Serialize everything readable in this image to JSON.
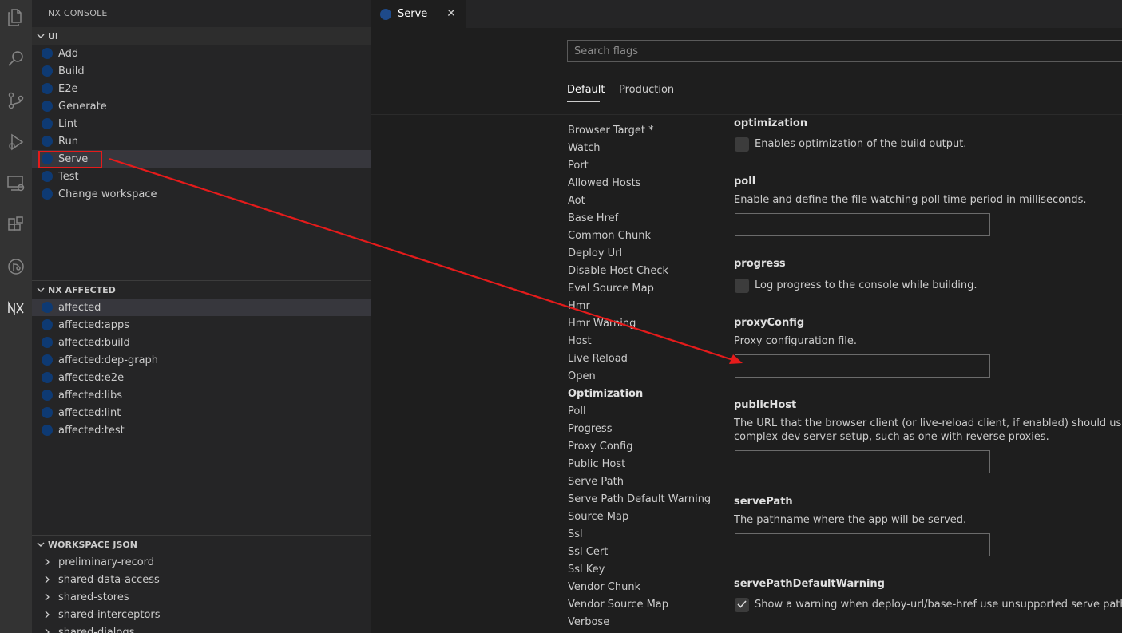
{
  "sidebar": {
    "title": "NX CONSOLE",
    "ui_section": {
      "header": "UI",
      "items": [
        {
          "label": "Add"
        },
        {
          "label": "Build"
        },
        {
          "label": "E2e"
        },
        {
          "label": "Generate"
        },
        {
          "label": "Lint"
        },
        {
          "label": "Run"
        },
        {
          "label": "Serve"
        },
        {
          "label": "Test"
        },
        {
          "label": "Change workspace"
        }
      ]
    },
    "affected_section": {
      "header": "NX AFFECTED",
      "items": [
        {
          "label": "affected"
        },
        {
          "label": "affected:apps"
        },
        {
          "label": "affected:build"
        },
        {
          "label": "affected:dep-graph"
        },
        {
          "label": "affected:e2e"
        },
        {
          "label": "affected:libs"
        },
        {
          "label": "affected:lint"
        },
        {
          "label": "affected:test"
        }
      ]
    },
    "workspace_section": {
      "header": "WORKSPACE JSON",
      "items": [
        {
          "label": "preliminary-record"
        },
        {
          "label": "shared-data-access"
        },
        {
          "label": "shared-stores"
        },
        {
          "label": "shared-interceptors"
        },
        {
          "label": "shared-dialogs"
        }
      ]
    }
  },
  "editor": {
    "tab": {
      "label": "Serve",
      "close": "✕"
    },
    "search_placeholder": "Search flags",
    "config_tabs": [
      {
        "label": "Default",
        "active": true
      },
      {
        "label": "Production",
        "active": false
      }
    ],
    "flag_nav": [
      "Browser Target *",
      "Watch",
      "Port",
      "Allowed Hosts",
      "Aot",
      "Base Href",
      "Common Chunk",
      "Deploy Url",
      "Disable Host Check",
      "Eval Source Map",
      "Hmr",
      "Hmr Warning",
      "Host",
      "Live Reload",
      "Open",
      "Optimization",
      "Poll",
      "Progress",
      "Proxy Config",
      "Public Host",
      "Serve Path",
      "Serve Path Default Warning",
      "Source Map",
      "Ssl",
      "Ssl Cert",
      "Ssl Key",
      "Vendor Chunk",
      "Vendor Source Map",
      "Verbose"
    ],
    "active_flag": "Optimization",
    "fields": {
      "optimization": {
        "name": "optimization",
        "desc": "Enables optimization of the build output.",
        "checked": false
      },
      "poll": {
        "name": "poll",
        "desc": "Enable and define the file watching poll time period in milliseconds.",
        "value": ""
      },
      "progress": {
        "name": "progress",
        "desc": "Log progress to the console while building.",
        "checked": false
      },
      "proxyConfig": {
        "name": "proxyConfig",
        "desc": "Proxy configuration file.",
        "value": ""
      },
      "publicHost": {
        "name": "publicHost",
        "desc1": "The URL that the browser client (or live-reload client, if enabled) should use to conne",
        "desc2": "complex dev server setup, such as one with reverse proxies.",
        "value": ""
      },
      "servePath": {
        "name": "servePath",
        "desc": "The pathname where the app will be served.",
        "value": ""
      },
      "servePathDefaultWarning": {
        "name": "servePathDefaultWarning",
        "desc": "Show a warning when deploy-url/base-href use unsupported serve path values.",
        "checked": true
      }
    }
  },
  "colors": {
    "highlight": "#e51b1b",
    "accent_dot": "#0e3a73"
  }
}
